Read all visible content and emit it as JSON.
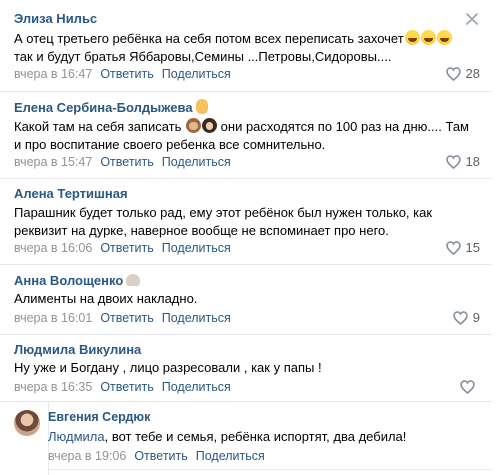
{
  "comments": [
    {
      "author": "Элиза Нильс",
      "line1": "А отец третьего ребёнка на себя потом всех переписать захочет",
      "line2": "так и будут братья Яббаровы,Семины ...Петровы,Сидоровы....",
      "time": "вчера в 16:47",
      "reply": "Ответить",
      "share": "Поделиться",
      "likes": "28",
      "emoji": [
        "laughing-tears",
        "laughing-tears",
        "laughing-tears"
      ]
    },
    {
      "author": "Елена Сербина-Болдыжева",
      "line1_a": "Какой там на себя записать",
      "line1_b": "они расходятся по 100 раз на дню.... Там",
      "line2": "и про воспитание своего ребенка все сомнительно.",
      "time": "вчера в 15:47",
      "reply": "Ответить",
      "share": "Поделиться",
      "likes": "18",
      "emoji": [
        "ok-hand",
        "see-no-evil-monkey",
        "woman"
      ]
    },
    {
      "author": "Алена Тертишная",
      "line1": "Парашник будет только рад, ему этот ребёнок был нужен только, как",
      "line2": "реквизит на дурке, наверное вообще не вспоминает про него.",
      "time": "вчера в 16:06",
      "reply": "Ответить",
      "share": "Поделиться",
      "likes": "15"
    },
    {
      "author": "Анна Волощенко",
      "line1": "Алименты на двоих накладно.",
      "time": "вчера в 16:01",
      "reply": "Ответить",
      "share": "Поделиться",
      "likes": "9",
      "emoji": [
        "shell"
      ]
    },
    {
      "author": "Людмила Викулина",
      "line1": "Ну уже и Богдану , лицо разресовали , как у папы !",
      "time": "вчера в 16:35",
      "reply": "Ответить",
      "share": "Поделиться",
      "likes": ""
    },
    {
      "author": "Евгения Сердюк",
      "mention": "Людмила",
      "line1": ", вот тебе и семья, ребёнка испортят, два дебила!",
      "time": "вчера в 19:06",
      "reply": "Ответить",
      "share": "Поделиться",
      "likes": ""
    }
  ],
  "colors": {
    "link": "#2a5885",
    "meta": "#939393",
    "separator": "#e7e8ec"
  },
  "icons": {
    "close": "close-icon",
    "like": "heart-icon"
  }
}
